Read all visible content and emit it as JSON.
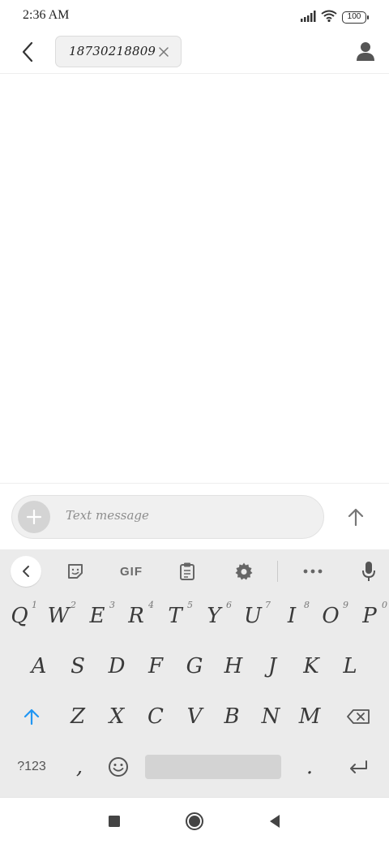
{
  "status_bar": {
    "time": "2:36 AM",
    "battery": "100",
    "icons": [
      "signal-icon",
      "wifi-icon",
      "battery-icon"
    ]
  },
  "header": {
    "recipient": "18730218809",
    "back_icon": "chevron-left-icon",
    "remove_icon": "close-icon",
    "contact_icon": "person-icon"
  },
  "compose": {
    "placeholder": "Text message",
    "add_icon": "plus-icon",
    "send_icon": "arrow-up-icon"
  },
  "keyboard": {
    "toolbar": {
      "gif_label": "GIF",
      "items": [
        "back-icon",
        "sticker-icon",
        "gif",
        "clipboard-icon",
        "gear-icon",
        "more-icon",
        "mic-icon"
      ]
    },
    "row1": [
      "Q",
      "W",
      "E",
      "R",
      "T",
      "Y",
      "U",
      "I",
      "O",
      "P"
    ],
    "row1_hints": [
      "1",
      "2",
      "3",
      "4",
      "5",
      "6",
      "7",
      "8",
      "9",
      "0"
    ],
    "row2": [
      "A",
      "S",
      "D",
      "F",
      "G",
      "H",
      "J",
      "K",
      "L"
    ],
    "row3": [
      "Z",
      "X",
      "C",
      "V",
      "B",
      "N",
      "M"
    ],
    "bottom": {
      "symbols_label": "?123",
      "comma": ",",
      "period": "."
    }
  },
  "colors": {
    "accent": "#2196f3",
    "keyboard_bg": "#ebebeb",
    "chip_bg": "#f1f1f1"
  }
}
